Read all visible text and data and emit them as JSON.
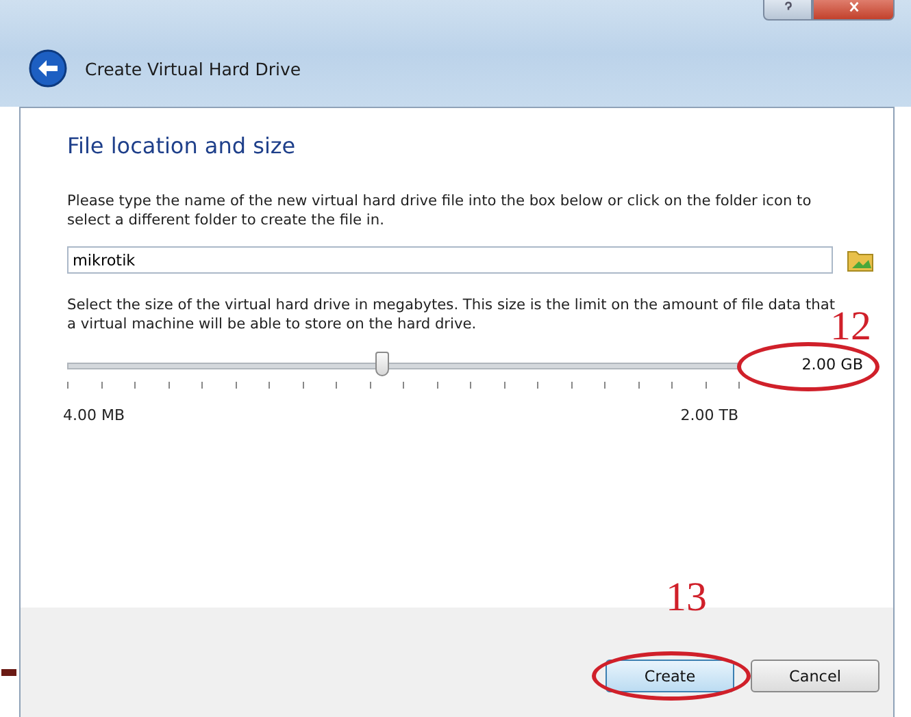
{
  "window": {
    "title": "Create Virtual Hard Drive"
  },
  "page": {
    "heading": "File location and size",
    "location_text": "Please type the name of the new virtual hard drive file into the box below or click on the folder icon to select a different folder to create the file in.",
    "file_name": "mikrotik",
    "size_text": "Select the size of the virtual hard drive in megabytes. This size is the limit on the amount of file data that a virtual machine will be able to store on the hard drive.",
    "size_slider": {
      "level": 0.47,
      "min_label": "4.00 MB",
      "max_label": "2.00 TB"
    },
    "size_value": {
      "text": "2.00 GB",
      "annotation": "12"
    }
  },
  "buttons": [
    {
      "label": "Create",
      "default": true,
      "annotation": "13"
    },
    {
      "label": "Cancel",
      "default": false
    }
  ]
}
